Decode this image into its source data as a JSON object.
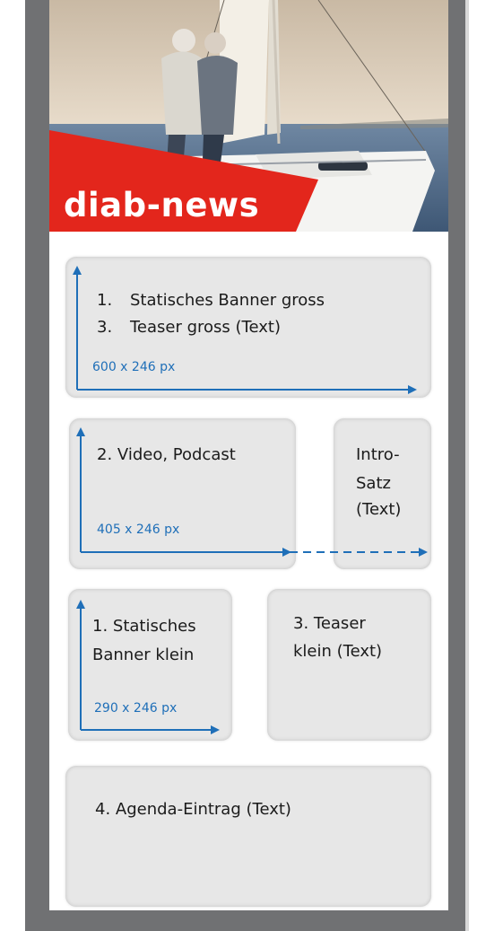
{
  "brand": {
    "name": "diab-news"
  },
  "colors": {
    "accent": "#e3261c",
    "frame": "#707173",
    "card": "#e7e7e7",
    "arrow": "#1f6fb8"
  },
  "blocks": {
    "banner_gross": {
      "items": [
        "1.",
        "Statisches Banner gross",
        "3.",
        "Teaser gross (Text)"
      ],
      "dimension": "600  x 246 px"
    },
    "video": {
      "label": "2. Video, Podcast",
      "dimension": "405 x 246 px"
    },
    "intro": {
      "lines": [
        "Intro-",
        "Satz",
        "(Text)"
      ]
    },
    "banner_klein": {
      "lines": [
        "1. Statisches",
        "Banner klein"
      ],
      "dimension": "290 x 246 px"
    },
    "teaser_klein": {
      "lines": [
        "3. Teaser",
        "klein (Text)"
      ]
    },
    "agenda": {
      "label": "4. Agenda-Eintrag (Text)"
    }
  }
}
